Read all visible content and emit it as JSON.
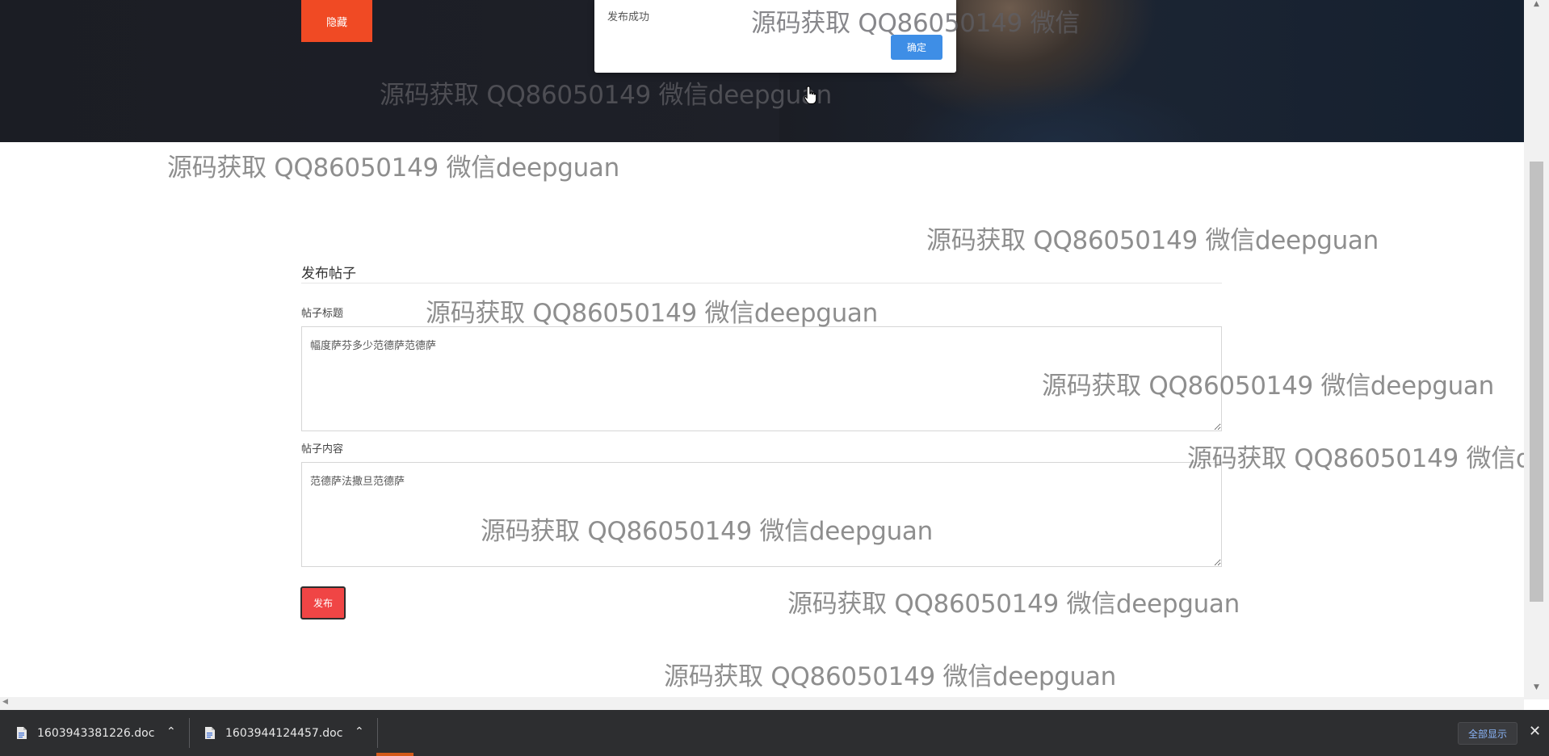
{
  "hero": {
    "hide_button_label": "隐藏"
  },
  "dialog": {
    "message": "发布成功",
    "ok_label": "确定"
  },
  "form": {
    "title": "发布帖子",
    "post_title_label": "帖子标题",
    "post_title_value": "幅度萨芬多少范德萨范德萨",
    "post_content_label": "帖子内容",
    "post_content_value": "范德萨法撒旦范德萨",
    "publish_label": "发布"
  },
  "watermark": {
    "text": "源码获取 QQ86050149 微信deepguan",
    "text_cut": "源码获取 QQ86050149 微信"
  },
  "downloads": {
    "items": [
      {
        "filename": "1603943381226.doc"
      },
      {
        "filename": "1603944124457.doc"
      }
    ],
    "show_all_label": "全部显示"
  },
  "icons": {
    "cursor": "hand-pointer-icon",
    "doc": "document-icon",
    "chevron": "chevron-up-icon",
    "close": "close-icon"
  }
}
